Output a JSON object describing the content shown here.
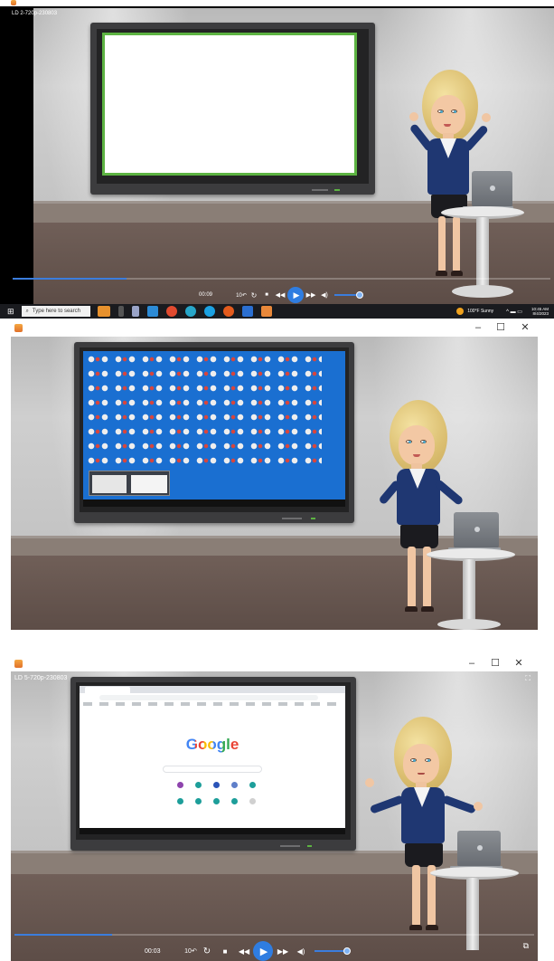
{
  "frame1": {
    "title_bar": {
      "window_title": "LD 2-720p-230803"
    },
    "player": {
      "time": "00:09",
      "skip_back_label": "10",
      "progress": 0.21
    }
  },
  "taskbar": {
    "search_placeholder": "Type here to search",
    "weather": "100°F  Sunny",
    "clock_time": "10:45 AM",
    "clock_date": "8/4/2023"
  },
  "frame2": {
    "window_controls": {
      "minimize": "–",
      "maximize": "☐",
      "close": "✕"
    }
  },
  "frame3": {
    "title_bar": {
      "window_title": "LD 5-720p-230803"
    },
    "window_controls": {
      "minimize": "–",
      "maximize": "☐",
      "close": "✕"
    },
    "browser": {
      "logo": "Google"
    },
    "player": {
      "time": "00:03",
      "skip_back_label": "10",
      "progress": 0.18
    }
  },
  "colors": {
    "accent": "#2f7de1",
    "whiteboard_border": "#5db342",
    "desktop_blue": "#1a6fd1"
  },
  "icons": [
    "app-icon",
    "play-icon",
    "skip-back-icon",
    "restart-icon",
    "stop-icon",
    "rewind-icon",
    "fast-forward-icon",
    "volume-icon",
    "fullscreen-icon",
    "windows-start-icon",
    "search-icon",
    "weather-icon"
  ]
}
